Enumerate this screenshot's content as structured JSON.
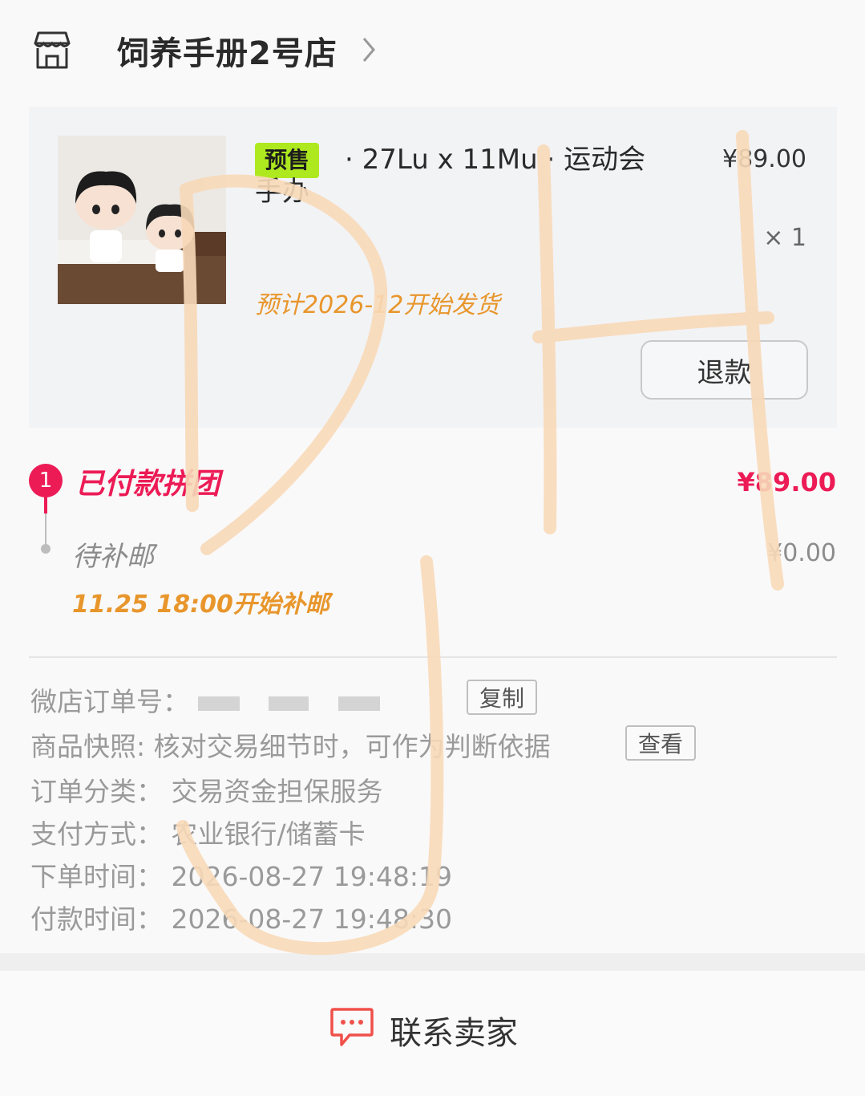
{
  "header": {
    "shop_name": "饲养手册2号店"
  },
  "product": {
    "tag": "预售",
    "title": "· 27Lu x 11Mu · 运动会手办",
    "price": "¥89.00",
    "quantity": "× 1",
    "ship_note": "预计2026-12开始发货",
    "refund_label": "退款"
  },
  "steps": [
    {
      "index": "1",
      "label": "已付款拼团",
      "amount": "¥89.00"
    },
    {
      "label": "待补邮",
      "amount": "¥0.00",
      "note": "11.25 18:00开始补邮"
    }
  ],
  "info": {
    "order_no_label": "微店订单号：",
    "copy_label": "复制",
    "snapshot_label": "商品快照:",
    "snapshot_value": "核对交易细节时，可作为判断依据",
    "view_label": "查看",
    "category_label": "订单分类：",
    "category_value": "交易资金担保服务",
    "payment_label": "支付方式：",
    "payment_value": "农业银行/储蓄卡",
    "order_time_label": "下单时间：",
    "order_time_value": "2026-08-27 19:48:19",
    "pay_time_label": "付款时间：",
    "pay_time_value": "2026-08-27 19:48:30"
  },
  "footer": {
    "contact_label": "联系卖家"
  },
  "colors": {
    "accent": "#ec1b56",
    "note_orange": "#e8962c",
    "tag_green": "#aee91f",
    "watermark": "#f8d9b8"
  }
}
